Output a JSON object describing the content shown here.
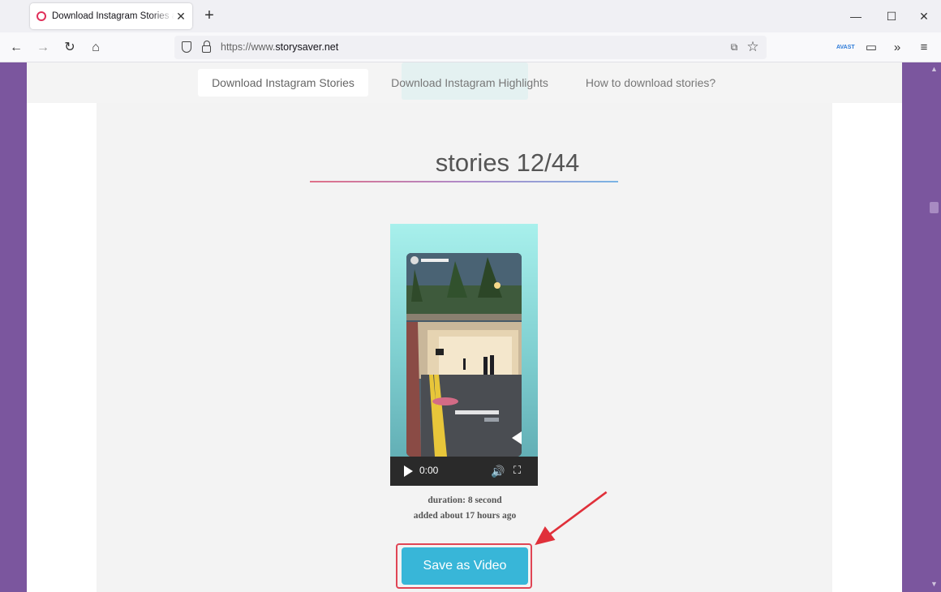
{
  "browser": {
    "tab_title": "Download Instagram Stories an",
    "tab_close": "✕",
    "new_tab": "+",
    "url_prefix": "https://www.",
    "url_domain": "storysaver.net",
    "window_controls": [
      "—",
      "☐",
      "✕"
    ],
    "extension_label": "AVAST"
  },
  "page_nav": {
    "items": [
      {
        "label": "Download Instagram Stories",
        "active": true
      },
      {
        "label": "Download Instagram Highlights",
        "active": false
      },
      {
        "label": "How to download stories?",
        "active": false
      }
    ]
  },
  "stories": {
    "title": "stories 12/44",
    "video_time": "0:00",
    "duration": "duration: 8 second",
    "added": "added about 17 hours ago",
    "save_label": "Save as Video"
  },
  "colors": {
    "accent": "#38b6d8",
    "sidebar": "#7b569e",
    "highlight": "#e04555"
  }
}
